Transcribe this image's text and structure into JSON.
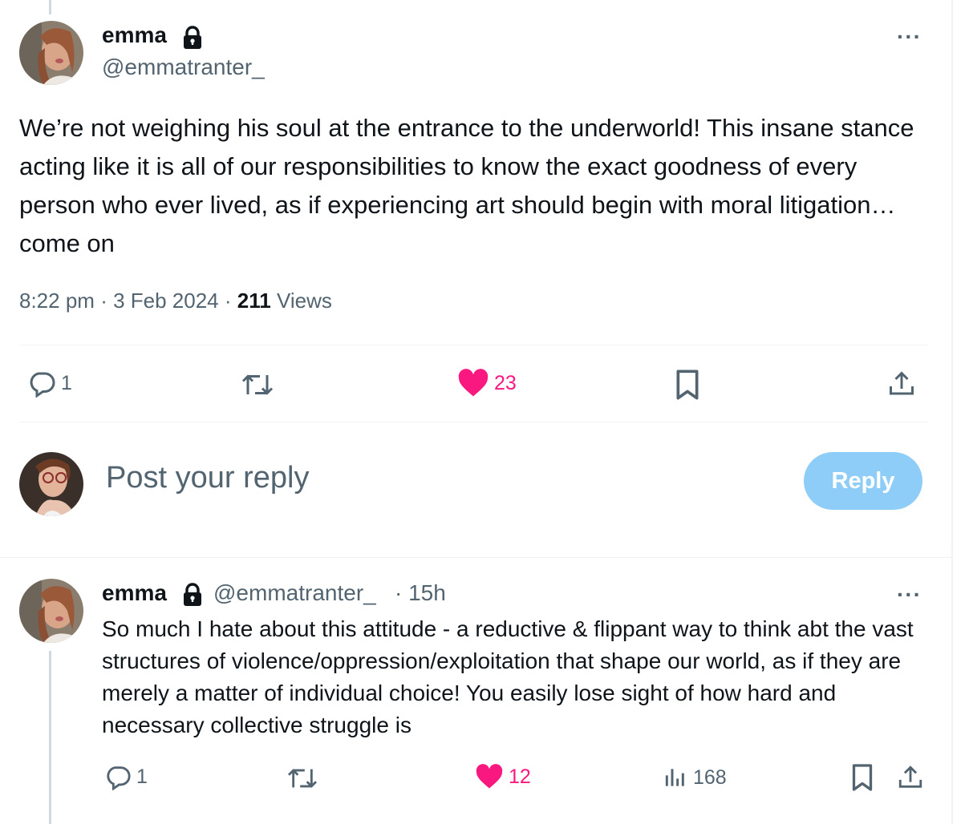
{
  "main_tweet": {
    "author_name": "emma",
    "author_handle": "@emmatranter_",
    "text": "We’re not weighing his soul at the entrance to the underworld! This insane  stance acting like it is all of our responsibilities to know the exact goodness of every person who ever lived, as if experiencing art should begin with moral litigation… come on",
    "time": "8:22 pm",
    "date": "3 Feb 2024",
    "views_count": "211",
    "views_label": "Views",
    "separator": "·",
    "more_label": "···",
    "actions": {
      "reply_count": "1",
      "like_count": "23"
    }
  },
  "composer": {
    "placeholder": "Post your reply",
    "button_label": "Reply"
  },
  "reply_tweet": {
    "author_name": "emma",
    "author_handle": "@emmatranter_",
    "time_meta": "· 15h",
    "more_label": "···",
    "text": "So much I hate about this attitude - a reductive & flippant way to think abt the vast structures of violence/oppression/exploitation that shape our world, as if they are merely a matter of individual choice! You easily lose sight of how hard and necessary collective struggle is",
    "actions": {
      "reply_count": "1",
      "like_count": "12",
      "views_count": "168"
    }
  },
  "icons": {
    "reply": "speech-bubble-icon",
    "repost": "repost-arrows-icon",
    "like": "heart-icon",
    "bookmark": "bookmark-icon",
    "share": "share-upload-icon",
    "views": "bar-chart-icon",
    "lock": "lock-icon"
  },
  "colors": {
    "like_active": "#f91880",
    "secondary_text": "#536471",
    "primary_text": "#0f1419",
    "reply_button_disabled": "#8ecdf8",
    "divider": "#eff3f4"
  }
}
